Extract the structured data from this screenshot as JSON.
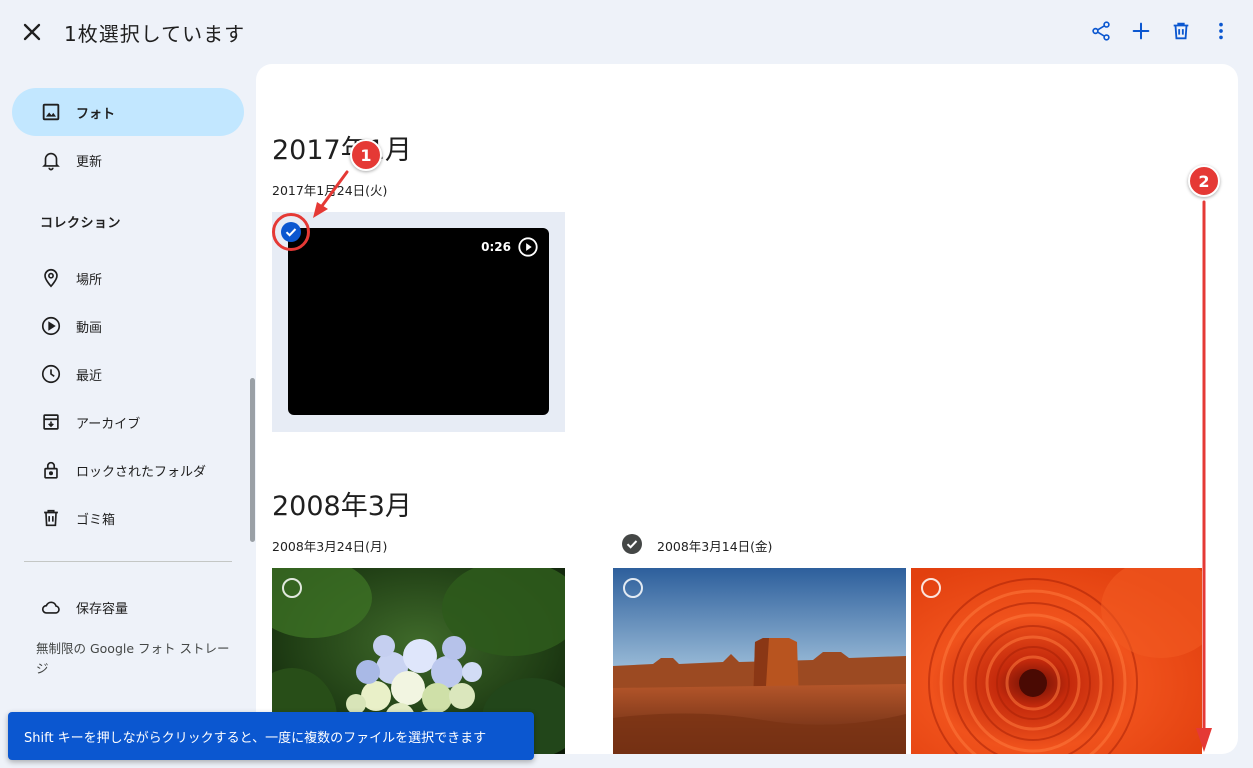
{
  "header": {
    "title": "1枚選択しています",
    "actions": [
      "share-icon",
      "add-icon",
      "trash-icon",
      "more-vert-icon"
    ]
  },
  "sidebar": {
    "items": [
      {
        "label": "フォト",
        "icon": "photo-icon",
        "active": true
      },
      {
        "label": "更新",
        "icon": "bell-icon"
      }
    ],
    "collections_title": "コレクション",
    "collections": [
      {
        "label": "場所",
        "icon": "location-icon"
      },
      {
        "label": "動画",
        "icon": "play-circle-icon"
      },
      {
        "label": "最近",
        "icon": "clock-icon"
      },
      {
        "label": "アーカイブ",
        "icon": "archive-icon"
      },
      {
        "label": "ロックされたフォルダ",
        "icon": "lock-icon"
      },
      {
        "label": "ゴミ箱",
        "icon": "trash-icon"
      }
    ],
    "storage": {
      "label": "保存容量",
      "icon": "cloud-icon",
      "note": "無制限の Google フォト ストレージ"
    }
  },
  "main": {
    "groups": [
      {
        "month": "2017年1月",
        "days": [
          {
            "date": "2017年1月24日(火)",
            "items": [
              {
                "type": "video",
                "duration": "0:26",
                "selected": true
              }
            ]
          }
        ]
      },
      {
        "month": "2008年3月",
        "days": [
          {
            "date": "2008年3月24日(月)",
            "items": [
              {
                "type": "photo",
                "subject": "hydrangea",
                "selected": false
              }
            ]
          },
          {
            "date": "2008年3月14日(金)",
            "group_checked": true,
            "items": [
              {
                "type": "photo",
                "subject": "desert-butte",
                "selected": false
              },
              {
                "type": "photo",
                "subject": "orange-chrysanthemum",
                "selected": false
              }
            ]
          }
        ]
      }
    ]
  },
  "annotations": {
    "badge_1": "1",
    "badge_2": "2",
    "color": "#e53935"
  },
  "toast": {
    "message": "Shift キーを押しながらクリックすると、一度に複数のファイルを選択できます"
  },
  "colors": {
    "accent": "#0b57d0",
    "active_nav": "#c2e7ff",
    "background": "#eef2f9"
  }
}
